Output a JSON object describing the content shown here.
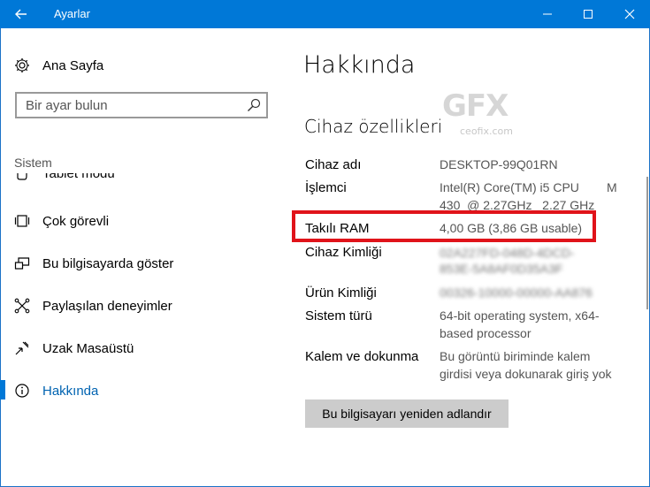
{
  "window": {
    "title": "Ayarlar"
  },
  "sidebar": {
    "home_label": "Ana Sayfa",
    "search_placeholder": "Bir ayar bulun",
    "section_label": "Sistem",
    "items": [
      {
        "label": "Tablet modu",
        "icon": "tablet-icon"
      },
      {
        "label": "Çok görevli",
        "icon": "multitasking-icon"
      },
      {
        "label": "Bu bilgisayarda göster",
        "icon": "project-icon"
      },
      {
        "label": "Paylaşılan deneyimler",
        "icon": "shared-experiences-icon"
      },
      {
        "label": "Uzak Masaüstü",
        "icon": "remote-desktop-icon"
      },
      {
        "label": "Hakkında",
        "icon": "info-icon",
        "active": true
      }
    ]
  },
  "main": {
    "title": "Hakkında",
    "section_title": "Cihaz özellikleri",
    "specs": {
      "device_name": {
        "label": "Cihaz adı",
        "value": "DESKTOP-99Q01RN"
      },
      "processor": {
        "label": "İşlemci",
        "value_line1": "Intel(R) Core(TM) i5 CPU        M",
        "value_line2": "430  @ 2.27GHz   2.27 GHz"
      },
      "ram": {
        "label": "Takılı RAM",
        "value": "4,00 GB (3,86 GB usable)"
      },
      "device_id": {
        "label": "Cihaz Kimliği",
        "value_line1": "02A227FD-048D-4DCD-",
        "value_line2": "853E-5A8AF0D35A3F"
      },
      "product_id": {
        "label": "Ürün Kimliği",
        "value": "00326-10000-00000-AA876"
      },
      "system_type": {
        "label": "Sistem türü",
        "value_line1": "64-bit operating system, x64-",
        "value_line2": "based processor"
      },
      "pen_touch": {
        "label": "Kalem ve dokunma",
        "value_line1": "Bu görüntü biriminde kalem",
        "value_line2": "girdisi veya dokunarak giriş yok"
      }
    },
    "rename_button": "Bu bilgisayarı yeniden adlandır"
  },
  "watermark": {
    "logo": "GFX",
    "site": "ceofix.com"
  },
  "colors": {
    "accent": "#0078d7",
    "highlight_box": "#e0131a",
    "button_bg": "#cccccc"
  }
}
